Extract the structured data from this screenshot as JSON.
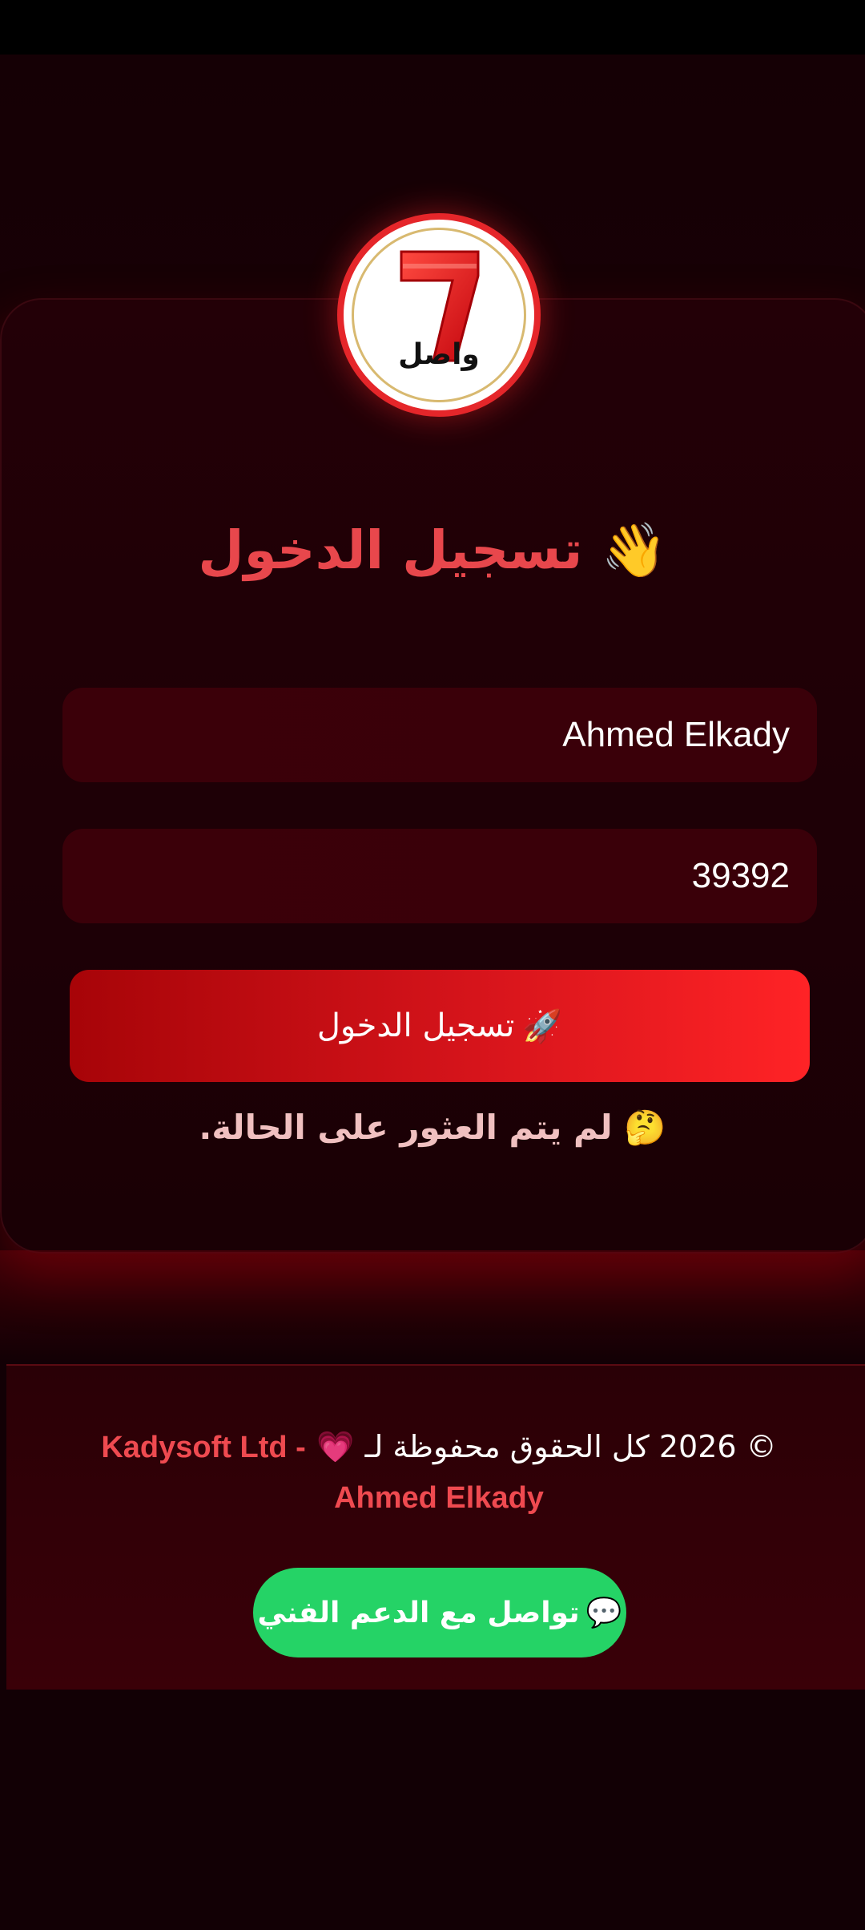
{
  "logo": {
    "text": "واصل"
  },
  "login": {
    "title_icon": "👋",
    "title": "تسجيل الدخول",
    "name_value": "Ahmed Elkady",
    "code_value": "39392",
    "button_icon": "🚀",
    "button_label": "تسجيل الدخول",
    "status_icon": "🤔",
    "status_message": "لم يتم العثور على الحالة."
  },
  "footer": {
    "copyright": "© 2026 كل الحقوق محفوظة لـ",
    "heart_icon": "💗",
    "owner": "Kadysoft Ltd - Ahmed Elkady",
    "support_icon": "💬",
    "support_label": "تواصل مع الدعم الفني"
  },
  "colors": {
    "accent": "#e8474c",
    "button": "#e5161c",
    "support": "#25d366",
    "background": "#120005"
  }
}
